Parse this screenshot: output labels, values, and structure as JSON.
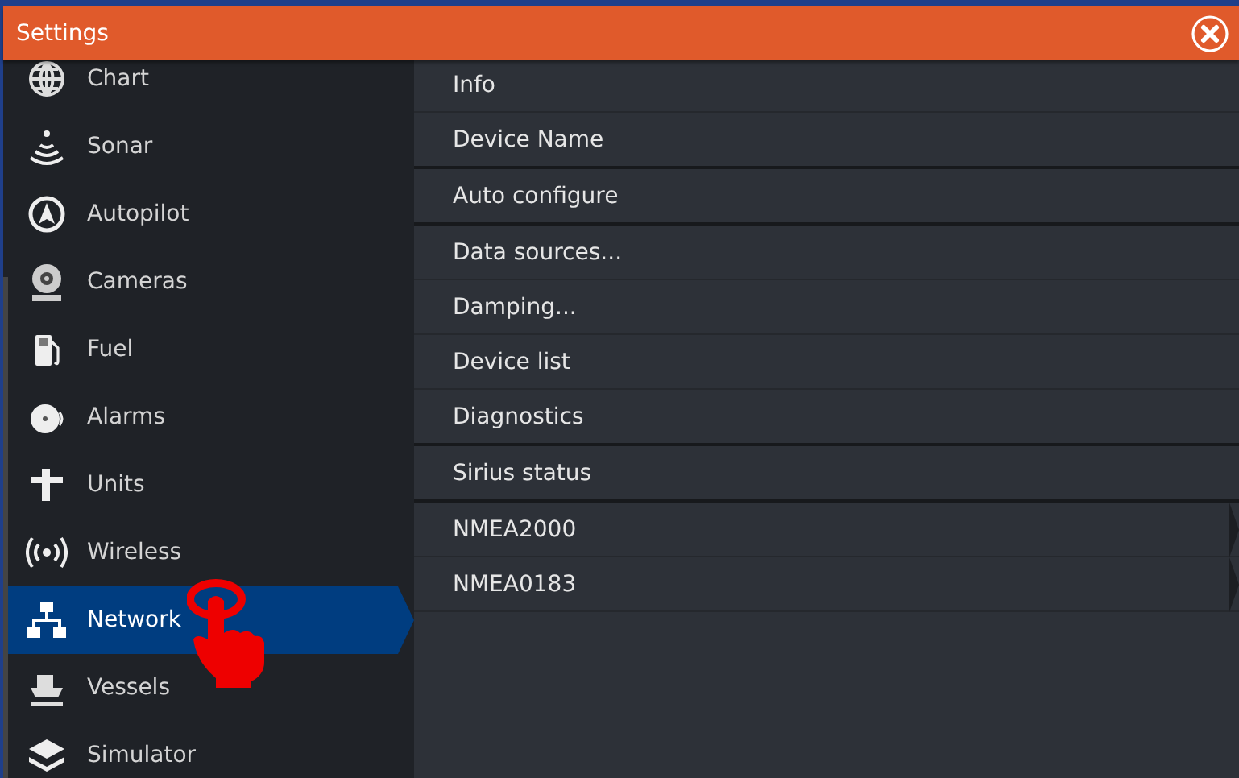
{
  "window": {
    "title": "Settings"
  },
  "sidebar": {
    "items": [
      {
        "label": "Chart",
        "selected": false
      },
      {
        "label": "Sonar",
        "selected": false
      },
      {
        "label": "Autopilot",
        "selected": false
      },
      {
        "label": "Cameras",
        "selected": false
      },
      {
        "label": "Fuel",
        "selected": false
      },
      {
        "label": "Alarms",
        "selected": false
      },
      {
        "label": "Units",
        "selected": false
      },
      {
        "label": "Wireless",
        "selected": false
      },
      {
        "label": "Network",
        "selected": true
      },
      {
        "label": "Vessels",
        "selected": false
      },
      {
        "label": "Simulator",
        "selected": false
      }
    ]
  },
  "menu": {
    "rows": [
      {
        "label": "Info",
        "kind": "plain",
        "separator": false
      },
      {
        "label": "Device Name",
        "kind": "plain",
        "separator": true
      },
      {
        "label": "Auto configure",
        "kind": "plain",
        "separator": true
      },
      {
        "label": "Data sources...",
        "kind": "plain",
        "separator": false
      },
      {
        "label": "Damping...",
        "kind": "plain",
        "separator": false
      },
      {
        "label": "Device list",
        "kind": "plain",
        "separator": false
      },
      {
        "label": "Diagnostics",
        "kind": "plain",
        "separator": true
      },
      {
        "label": "Sirius status",
        "kind": "plain",
        "separator": true
      },
      {
        "label": "NMEA2000",
        "kind": "submenu",
        "separator": false
      },
      {
        "label": "NMEA0183",
        "kind": "submenu",
        "separator": false
      }
    ]
  }
}
